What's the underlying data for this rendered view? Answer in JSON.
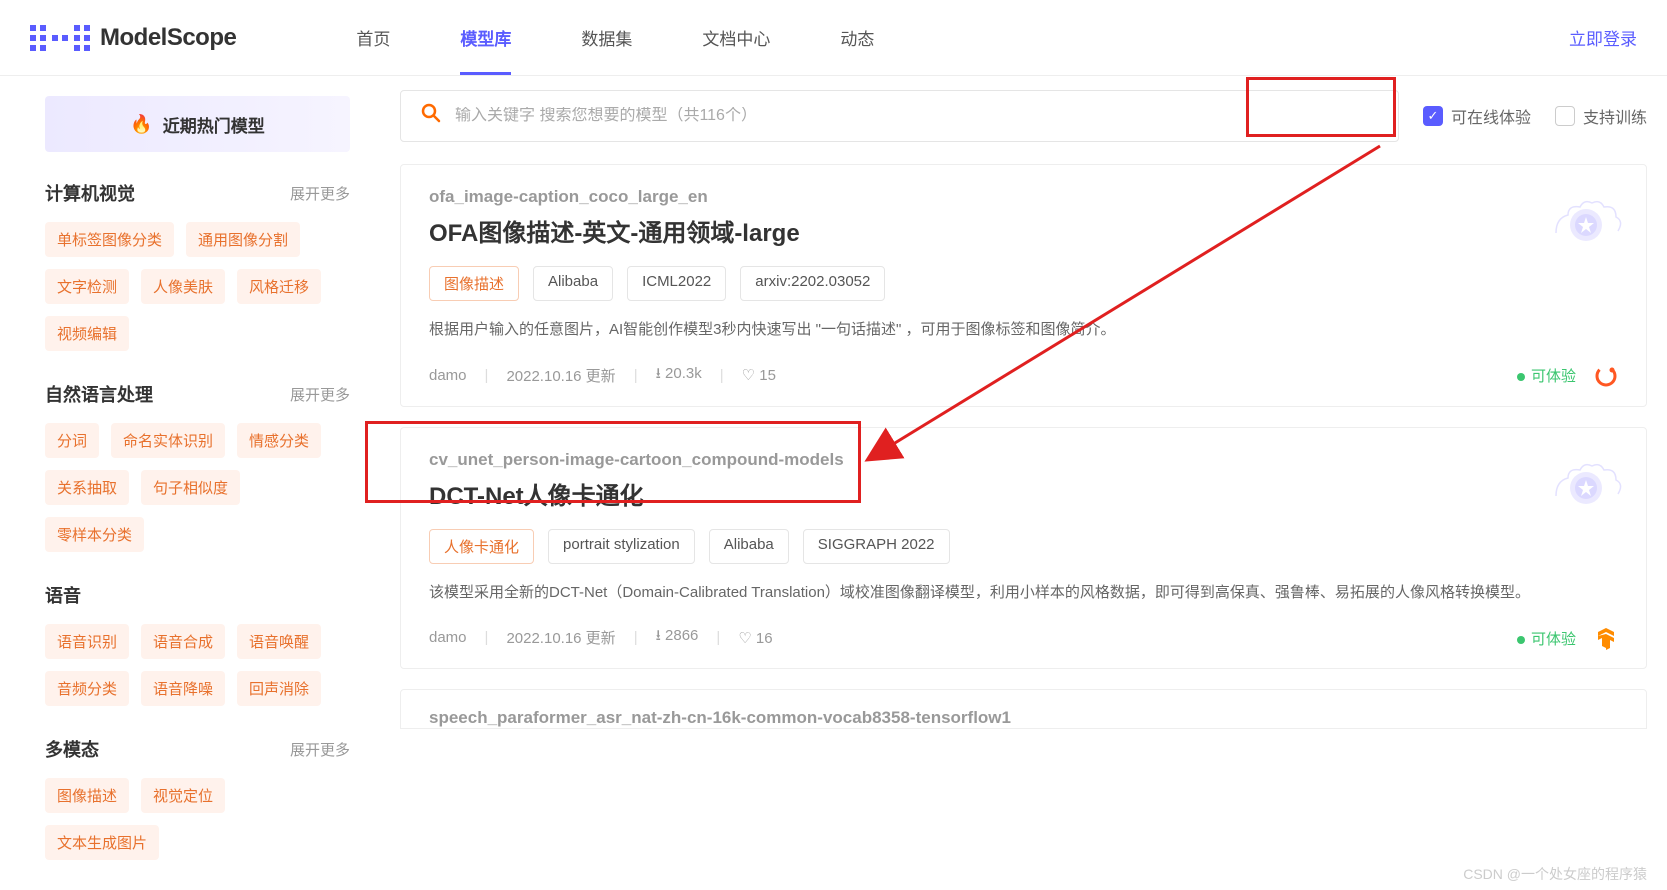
{
  "header": {
    "logo_text": "ModelScope",
    "nav": [
      "首页",
      "模型库",
      "数据集",
      "文档中心",
      "动态"
    ],
    "nav_active_index": 1,
    "login": "立即登录"
  },
  "sidebar": {
    "hot_label": "近期热门模型",
    "categories": [
      {
        "title": "计算机视觉",
        "more": "展开更多",
        "tags": [
          "单标签图像分类",
          "通用图像分割",
          "文字检测",
          "人像美肤",
          "风格迁移",
          "视频编辑"
        ]
      },
      {
        "title": "自然语言处理",
        "more": "展开更多",
        "tags": [
          "分词",
          "命名实体识别",
          "情感分类",
          "关系抽取",
          "句子相似度",
          "零样本分类"
        ]
      },
      {
        "title": "语音",
        "more": "",
        "tags": [
          "语音识别",
          "语音合成",
          "语音唤醒",
          "音频分类",
          "语音降噪",
          "回声消除"
        ]
      },
      {
        "title": "多模态",
        "more": "展开更多",
        "tags": [
          "图像描述",
          "视觉定位",
          "文本生成图片"
        ]
      }
    ]
  },
  "main": {
    "search": {
      "placeholder": "输入关键字 搜索您想要的模型（共116个）"
    },
    "filters": {
      "online": "可在线体验",
      "train": "支持训练"
    },
    "cards": [
      {
        "slug": "ofa_image-caption_coco_large_en",
        "title": "OFA图像描述-英文-通用领域-large",
        "tags": [
          "图像描述",
          "Alibaba",
          "ICML2022",
          "arxiv:2202.03052"
        ],
        "primary_tag_index": 0,
        "desc": "根据用户输入的任意图片，AI智能创作模型3秒内快速写出 \"一句话描述\" ，可用于图像标签和图像简介。",
        "author": "damo",
        "updated": "2022.10.16 更新",
        "downloads": "20.3k",
        "likes": "15",
        "status": "可体验",
        "framework": "pytorch"
      },
      {
        "slug": "cv_unet_person-image-cartoon_compound-models",
        "title": "DCT-Net人像卡通化",
        "tags": [
          "人像卡通化",
          "portrait stylization",
          "Alibaba",
          "SIGGRAPH 2022"
        ],
        "primary_tag_index": 0,
        "desc": "该模型采用全新的DCT-Net（Domain-Calibrated Translation）域校准图像翻译模型，利用小样本的风格数据，即可得到高保真、强鲁棒、易拓展的人像风格转换模型。",
        "author": "damo",
        "updated": "2022.10.16 更新",
        "downloads": "2866",
        "likes": "16",
        "status": "可体验",
        "framework": "tensorflow"
      }
    ],
    "partial_slug": "speech_paraformer_asr_nat-zh-cn-16k-common-vocab8358-tensorflow1"
  },
  "watermark": "CSDN @一个处女座的程序猿"
}
